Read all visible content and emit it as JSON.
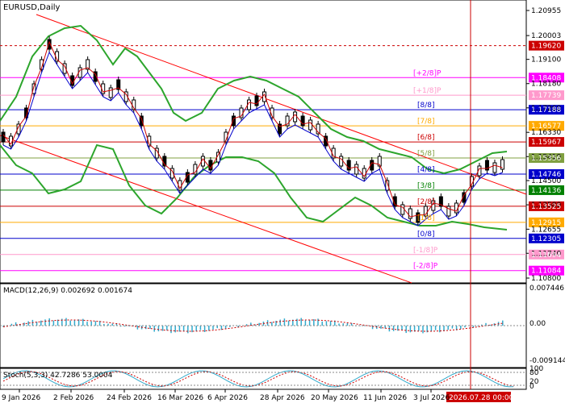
{
  "chart": {
    "symbol_label": "EURUSD,Daily",
    "macd_label": "MACD(12,26,9) 0.002692 0.001674",
    "stoch_label": "Stoch(5,3,3) 42.7286 53.0004",
    "cursor_time_label": "2026.07.28 00:00",
    "colors": {
      "price_up": "#000000",
      "resistance": "#ff0000",
      "support": "#ff0000",
      "bollinger": "#2ca52c",
      "murrey_red": "#cc0000",
      "murrey_green": "#008000",
      "murrey_blue": "#0000cc",
      "murrey_orange": "#ffaa00",
      "murrey_magenta": "#ff00ff",
      "murrey_pink": "#ff99cc",
      "macd_hist": "#33aacc"
    }
  },
  "price_axis": {
    "ticks": [
      "1.20955",
      "1.20003",
      "1.19100",
      "1.18180",
      "1.17260",
      "1.16330",
      "1.15410",
      "1.14500",
      "1.13580",
      "1.12655",
      "1.11740",
      "1.10800"
    ],
    "tagged_levels": [
      {
        "value": "1.19620",
        "color": "#cc0000"
      },
      {
        "value": "1.18408",
        "color": "#ff00ff"
      },
      {
        "value": "1.17739",
        "color": "#ff99cc"
      },
      {
        "value": "1.17188",
        "color": "#0000cc"
      },
      {
        "value": "1.16577",
        "color": "#ffaa00"
      },
      {
        "value": "1.15967",
        "color": "#cc0000"
      },
      {
        "value": "1.15356",
        "color": "#80a040"
      },
      {
        "value": "1.14746",
        "color": "#0000cc"
      },
      {
        "value": "1.14136",
        "color": "#008000"
      },
      {
        "value": "1.13525",
        "color": "#cc0000"
      },
      {
        "value": "1.12915",
        "color": "#ffaa00"
      },
      {
        "value": "1.12305",
        "color": "#0000cc"
      },
      {
        "value": "1.11694",
        "color": "#ff99cc"
      },
      {
        "value": "1.11084",
        "color": "#ff00ff"
      }
    ]
  },
  "murrey_levels": [
    {
      "label": "[+2/8]P",
      "color": "#ff00ff"
    },
    {
      "label": "[+1/8]P",
      "color": "#ff99cc"
    },
    {
      "label": "[8/8]",
      "color": "#0000cc"
    },
    {
      "label": "[7/8]",
      "color": "#ffaa00"
    },
    {
      "label": "[6/8]",
      "color": "#cc0000"
    },
    {
      "label": "[5/8]",
      "color": "#80a040"
    },
    {
      "label": "[4/8]",
      "color": "#0000cc"
    },
    {
      "label": "[3/8]",
      "color": "#008000"
    },
    {
      "label": "[2/8]",
      "color": "#cc0000"
    },
    {
      "label": "[1/8]",
      "color": "#ffaa00"
    },
    {
      "label": "[0/8]",
      "color": "#0000cc"
    },
    {
      "label": "[-1/8]P",
      "color": "#ff99cc"
    },
    {
      "label": "[-2/8]P",
      "color": "#ff00ff"
    }
  ],
  "macd_axis": {
    "ticks": [
      "0.007446",
      "0.00",
      "-0.009144"
    ]
  },
  "stoch_axis": {
    "ticks": [
      "100",
      "80",
      "20",
      "0"
    ]
  },
  "time_axis": {
    "ticks": [
      "9 Jan 2026",
      "2 Feb 2026",
      "24 Feb 2026",
      "16 Mar 2026",
      "6 Apr 2026",
      "28 Apr 2026",
      "20 May 2026",
      "11 Jun 2026",
      "3 Jul 2026"
    ]
  }
}
